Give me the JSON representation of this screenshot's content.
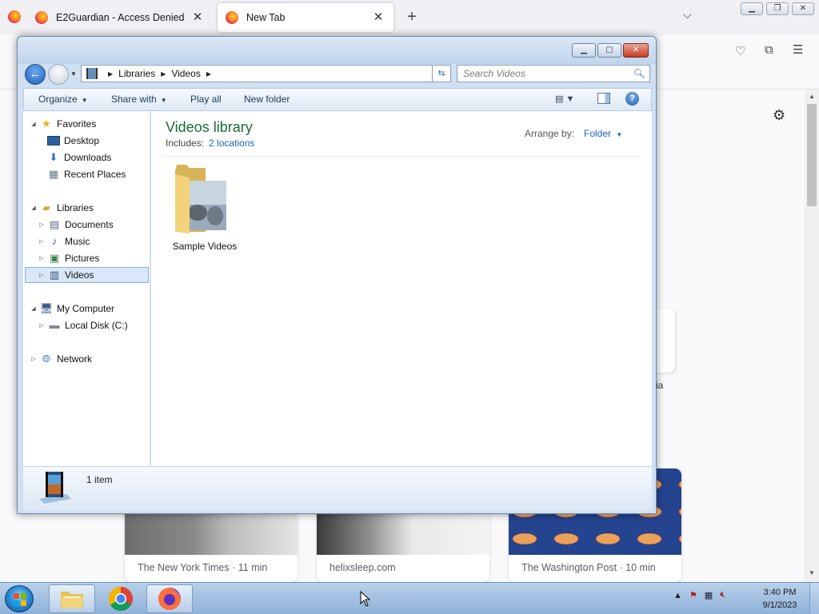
{
  "firefox": {
    "tabs": [
      {
        "title": "E2Guardian - Access Denied",
        "active": false
      },
      {
        "title": "New Tab",
        "active": true
      }
    ],
    "new_tab_label": "+",
    "side_label": "ia",
    "stories": [
      {
        "source": "The New York Times · 11 min"
      },
      {
        "source": "helixsleep.com"
      },
      {
        "source": "The Washington Post · 10 min"
      }
    ]
  },
  "explorer": {
    "breadcrumb": [
      "Libraries",
      "Videos"
    ],
    "search": {
      "placeholder": "Search Videos",
      "value": ""
    },
    "commands": {
      "organize": "Organize",
      "share_with": "Share with",
      "play_all": "Play all",
      "new_folder": "New folder"
    },
    "nav_tree": {
      "favorites": {
        "label": "Favorites",
        "items": [
          "Desktop",
          "Downloads",
          "Recent Places"
        ]
      },
      "libraries": {
        "label": "Libraries",
        "items": [
          "Documents",
          "Music",
          "Pictures",
          "Videos"
        ]
      },
      "computer": {
        "label": "My Computer",
        "items": [
          "Local Disk (C:)"
        ]
      },
      "network": {
        "label": "Network"
      }
    },
    "selected_nav_item": "Videos",
    "library": {
      "title": "Videos library",
      "includes_label": "Includes:",
      "includes_link": "2 locations",
      "arrange_label": "Arrange by:",
      "arrange_value": "Folder"
    },
    "items": [
      {
        "name": "Sample Videos",
        "type": "folder"
      }
    ],
    "status": {
      "count": "1 item"
    }
  },
  "taskbar": {
    "pinned": [
      "file-explorer",
      "chrome",
      "firefox"
    ],
    "clock_time": "3:40 PM",
    "clock_date": "9/1/2023"
  }
}
